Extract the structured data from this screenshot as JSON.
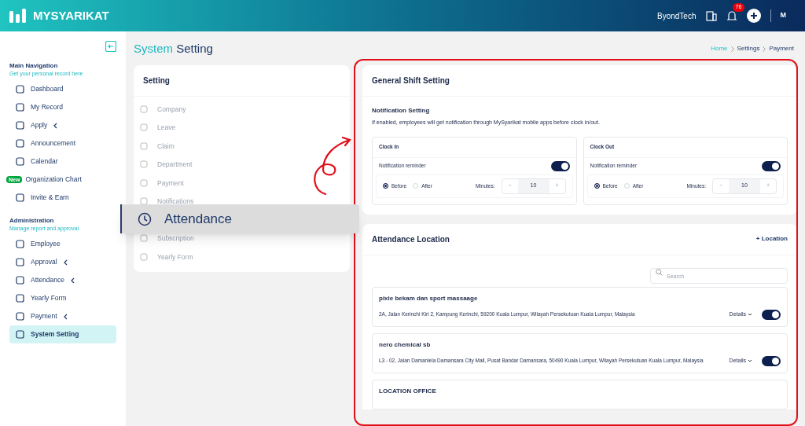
{
  "header": {
    "logo": "MYSYARIKAT",
    "company": "ByondTech",
    "notification_count": "76",
    "user_initials": "M"
  },
  "sidebar": {
    "sections": [
      {
        "title": "Main Navigation",
        "subtitle": "Get your personal record here",
        "items": [
          {
            "label": "Dashboard",
            "expandable": false,
            "selected": false
          },
          {
            "label": "My Record",
            "expandable": false,
            "selected": false
          },
          {
            "label": "Apply",
            "expandable": true,
            "selected": false
          },
          {
            "label": "Announcement",
            "expandable": false,
            "selected": false
          },
          {
            "label": "Calendar",
            "expandable": false,
            "selected": false
          },
          {
            "label": "Organization Chart",
            "badge": "New",
            "expandable": false,
            "selected": false
          },
          {
            "label": "Invite & Earn",
            "expandable": false,
            "selected": false
          }
        ]
      },
      {
        "title": "Administration",
        "subtitle": "Manage report and approval",
        "items": [
          {
            "label": "Employee",
            "expandable": false,
            "selected": false
          },
          {
            "label": "Approval",
            "expandable": true,
            "selected": false
          },
          {
            "label": "Attendance",
            "expandable": true,
            "selected": false
          },
          {
            "label": "Yearly Form",
            "expandable": false,
            "selected": false
          },
          {
            "label": "Payment",
            "expandable": true,
            "selected": false
          },
          {
            "label": "System Setting",
            "expandable": false,
            "selected": true
          }
        ]
      }
    ]
  },
  "page_title": {
    "first": "System",
    "second": "Setting"
  },
  "breadcrumb": [
    "Home",
    "Settings",
    "Payment"
  ],
  "settings_menu": {
    "title": "Setting",
    "items": [
      "Company",
      "Leave",
      "Claim",
      "Department",
      "Payment",
      "Notifications",
      "Subscription",
      "Yearly Form"
    ]
  },
  "callout": {
    "label": "Attendance"
  },
  "shift": {
    "title": "General Shift Setting",
    "notification_title": "Notification Setting",
    "notification_text": "If enabled, employees will get notification through MySyarikat mobile apps before clock in/out.",
    "cards": [
      {
        "title": "Clock In",
        "reminder_label": "Notification reminder",
        "on": true,
        "options": [
          {
            "label": "Before",
            "selected": true
          },
          {
            "label": "After",
            "selected": false
          }
        ],
        "minutes_label": "Minutes:",
        "minus": "−",
        "minutes": "10",
        "plus": "+"
      },
      {
        "title": "Clock Out",
        "reminder_label": "Notification reminder",
        "on": true,
        "options": [
          {
            "label": "Before",
            "selected": true
          },
          {
            "label": "After",
            "selected": false
          }
        ],
        "minutes_label": "Minutes:",
        "minus": "−",
        "minutes": "10",
        "plus": "+"
      }
    ]
  },
  "locations": {
    "title": "Attendance Location",
    "add": "+ Location",
    "search_placeholder": "Search",
    "items": [
      {
        "name": "pixie bekam dan sport massaage",
        "address": "2A, Jalan Kerinchi Kiri 2, Kampung Kerinchi, 59200 Kuala Lumpur, Wilayah Persekutuan Kuala Lumpur, Malaysia",
        "details": "Details",
        "on": true
      },
      {
        "name": "nero chemical sb",
        "address": "L3 - 02, Jalan Damanlela Damansara City Mall, Pusat Bandar Damansara, 50490 Kuala Lumpur, Wilayah Persekutuan Kuala Lumpur, Malaysia",
        "details": "Details",
        "on": true
      },
      {
        "name": "LOCATION OFFICE"
      }
    ]
  }
}
